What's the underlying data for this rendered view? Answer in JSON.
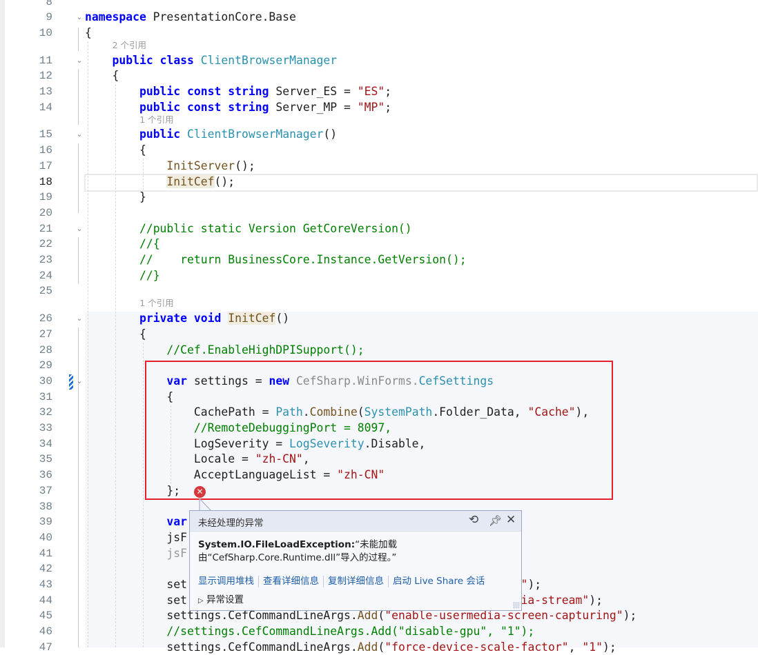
{
  "editor": {
    "current_line": 18,
    "lines": [
      {
        "n": 8,
        "tokens": []
      },
      {
        "n": 9,
        "fold": true,
        "tokens": [
          [
            "k",
            "namespace"
          ],
          [
            "p",
            " PresentationCore.Base"
          ]
        ]
      },
      {
        "n": 10,
        "tokens": [
          [
            "p",
            "{"
          ]
        ]
      },
      {
        "lens": "2 个引用",
        "indent": 4
      },
      {
        "n": 11,
        "fold": true,
        "tokens": [
          [
            "p",
            "    "
          ],
          [
            "k",
            "public"
          ],
          [
            "p",
            " "
          ],
          [
            "k",
            "class"
          ],
          [
            "p",
            " "
          ],
          [
            "t",
            "ClientBrowserManager"
          ]
        ]
      },
      {
        "n": 12,
        "tokens": [
          [
            "p",
            "    {"
          ]
        ]
      },
      {
        "n": 13,
        "tokens": [
          [
            "p",
            "        "
          ],
          [
            "k",
            "public"
          ],
          [
            "p",
            " "
          ],
          [
            "k",
            "const"
          ],
          [
            "p",
            " "
          ],
          [
            "k",
            "string"
          ],
          [
            "p",
            " Server_ES = "
          ],
          [
            "s",
            "\"ES\""
          ],
          [
            "p",
            ";"
          ]
        ]
      },
      {
        "n": 14,
        "tokens": [
          [
            "p",
            "        "
          ],
          [
            "k",
            "public"
          ],
          [
            "p",
            " "
          ],
          [
            "k",
            "const"
          ],
          [
            "p",
            " "
          ],
          [
            "k",
            "string"
          ],
          [
            "p",
            " Server_MP = "
          ],
          [
            "s",
            "\"MP\""
          ],
          [
            "p",
            ";"
          ]
        ]
      },
      {
        "lens": "1 个引用",
        "indent": 8
      },
      {
        "n": 15,
        "fold": true,
        "tokens": [
          [
            "p",
            "        "
          ],
          [
            "k",
            "public"
          ],
          [
            "p",
            " "
          ],
          [
            "t",
            "ClientBrowserManager"
          ],
          [
            "p",
            "()"
          ]
        ]
      },
      {
        "n": 16,
        "tokens": [
          [
            "p",
            "        {"
          ]
        ]
      },
      {
        "n": 17,
        "tokens": [
          [
            "p",
            "            "
          ],
          [
            "m",
            "InitServer"
          ],
          [
            "p",
            "();"
          ]
        ]
      },
      {
        "n": 18,
        "tokens": [
          [
            "p",
            "            "
          ],
          [
            "m hl",
            "InitCef"
          ],
          [
            "p",
            "();"
          ]
        ]
      },
      {
        "n": 19,
        "tokens": [
          [
            "p",
            "        }"
          ]
        ]
      },
      {
        "n": 20,
        "tokens": []
      },
      {
        "n": 21,
        "fold": true,
        "tokens": [
          [
            "p",
            "        "
          ],
          [
            "c",
            "//public static Version GetCoreVersion()"
          ]
        ]
      },
      {
        "n": 22,
        "tokens": [
          [
            "p",
            "        "
          ],
          [
            "c",
            "//{"
          ]
        ]
      },
      {
        "n": 23,
        "tokens": [
          [
            "p",
            "        "
          ],
          [
            "c",
            "//    return BusinessCore.Instance.GetVersion();"
          ]
        ]
      },
      {
        "n": 24,
        "tokens": [
          [
            "p",
            "        "
          ],
          [
            "c",
            "//}"
          ]
        ]
      },
      {
        "n": 25,
        "tokens": []
      },
      {
        "lens": "1 个引用",
        "indent": 8
      },
      {
        "n": 26,
        "fold": true,
        "tokens": [
          [
            "p",
            "        "
          ],
          [
            "k",
            "private"
          ],
          [
            "p",
            " "
          ],
          [
            "k",
            "void"
          ],
          [
            "p",
            " "
          ],
          [
            "m hl",
            "InitCef"
          ],
          [
            "p",
            "()"
          ]
        ]
      },
      {
        "n": 27,
        "tokens": [
          [
            "p",
            "        {"
          ]
        ]
      },
      {
        "n": 28,
        "tokens": [
          [
            "p",
            "            "
          ],
          [
            "c",
            "//Cef.EnableHighDPISupport();"
          ]
        ]
      },
      {
        "n": 29,
        "tokens": []
      },
      {
        "n": 30,
        "fold": true,
        "tokens": [
          [
            "p",
            "            "
          ],
          [
            "k",
            "var"
          ],
          [
            "p",
            " settings = "
          ],
          [
            "k",
            "new"
          ],
          [
            "p",
            " "
          ],
          [
            "g",
            "CefSharp.WinForms."
          ],
          [
            "t",
            "CefSettings"
          ]
        ]
      },
      {
        "n": 31,
        "tokens": [
          [
            "p",
            "            {"
          ]
        ]
      },
      {
        "n": 32,
        "tokens": [
          [
            "p",
            "                CachePath = "
          ],
          [
            "t",
            "Path"
          ],
          [
            "p",
            "."
          ],
          [
            "m",
            "Combine"
          ],
          [
            "p",
            "("
          ],
          [
            "t",
            "SystemPath"
          ],
          [
            "p",
            ".Folder_Data, "
          ],
          [
            "s",
            "\"Cache\""
          ],
          [
            "p",
            "),"
          ]
        ]
      },
      {
        "n": 33,
        "tokens": [
          [
            "p",
            "                "
          ],
          [
            "c",
            "//RemoteDebuggingPort = 8097,"
          ]
        ]
      },
      {
        "n": 34,
        "tokens": [
          [
            "p",
            "                LogSeverity = "
          ],
          [
            "t",
            "LogSeverity"
          ],
          [
            "p",
            ".Disable,"
          ]
        ]
      },
      {
        "n": 35,
        "tokens": [
          [
            "p",
            "                Locale = "
          ],
          [
            "s",
            "\"zh-CN\""
          ],
          [
            "p",
            ","
          ]
        ]
      },
      {
        "n": 36,
        "tokens": [
          [
            "p",
            "                AcceptLanguageList = "
          ],
          [
            "s",
            "\"zh-CN\""
          ]
        ]
      },
      {
        "n": 37,
        "tokens": [
          [
            "p",
            "            };"
          ]
        ]
      },
      {
        "n": 38,
        "tokens": []
      },
      {
        "n": 39,
        "tokens": [
          [
            "p",
            "            "
          ],
          [
            "k",
            "var"
          ]
        ]
      },
      {
        "n": 40,
        "tokens": [
          [
            "p",
            "            jsF"
          ]
        ]
      },
      {
        "n": 41,
        "tokens": [
          [
            "p",
            "            "
          ],
          [
            "f",
            "jsF"
          ]
        ]
      },
      {
        "n": 42,
        "tokens": []
      },
      {
        "n": 43,
        "tokens": [
          [
            "p",
            "            set                                                 "
          ],
          [
            "s",
            "\""
          ],
          [
            "p",
            ");"
          ]
        ]
      },
      {
        "n": 44,
        "tokens": [
          [
            "p",
            "            set                                                 "
          ],
          [
            "s",
            "ia-stream\""
          ],
          [
            "p",
            ");"
          ]
        ]
      },
      {
        "n": 45,
        "tokens": [
          [
            "p",
            "            settings.CefCommandLineArgs."
          ],
          [
            "m",
            "Add"
          ],
          [
            "p",
            "("
          ],
          [
            "s",
            "\"enable-usermedia-screen-capturing\""
          ],
          [
            "p",
            ");"
          ]
        ]
      },
      {
        "n": 46,
        "tokens": [
          [
            "p",
            "            "
          ],
          [
            "c",
            "//settings.CefCommandLineArgs.Add(\"disable-gpu\", \"1\");"
          ]
        ]
      },
      {
        "n": 47,
        "tokens": [
          [
            "p",
            "            settings.CefCommandLineArgs."
          ],
          [
            "m",
            "Add"
          ],
          [
            "p",
            "("
          ],
          [
            "s",
            "\"force-device-scale-factor\""
          ],
          [
            "p",
            ", "
          ],
          [
            "s",
            "\"1\""
          ],
          [
            "p",
            ");"
          ]
        ]
      }
    ]
  },
  "exception_popup": {
    "title": "未经处理的异常",
    "exception_type": "System.IO.FileLoadException:",
    "message_line1": "“未能加载",
    "message_line2": "由“CefSharp.Core.Runtime.dll”导入的过程。”",
    "links": [
      "显示调用堆栈",
      "查看详细信息",
      "复制详细信息",
      "启动 Live Share 会话"
    ],
    "settings_label": "异常设置",
    "icons": [
      "history-icon",
      "pin-icon",
      "close-icon"
    ]
  },
  "colors": {
    "keyword": "#0000ff",
    "type": "#2b91af",
    "string": "#a31515",
    "comment": "#008000",
    "error_box": "#e8202a"
  }
}
